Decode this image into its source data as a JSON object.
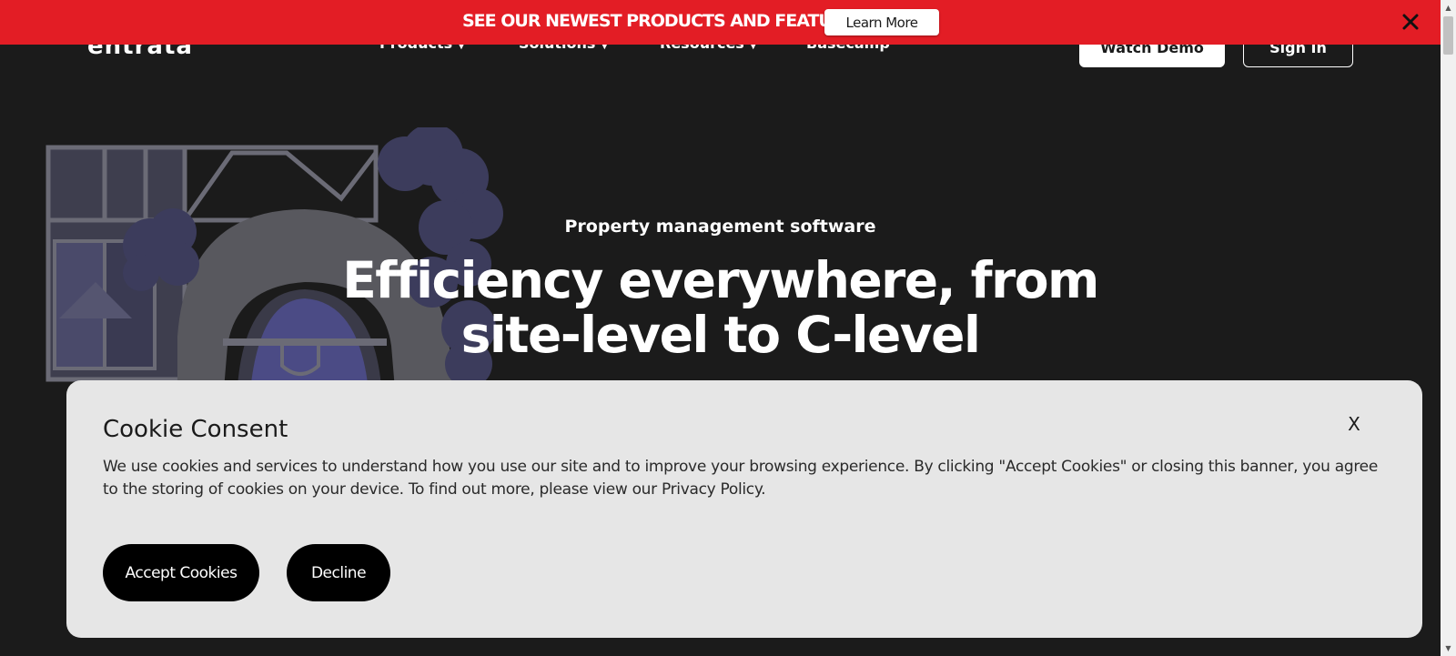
{
  "promo": {
    "text": "SEE OUR NEWEST PRODUCTS AND FEATURES",
    "button_label": "Learn More",
    "close_icon": "close-icon",
    "background": "#e31d25"
  },
  "header": {
    "logo": "entrata",
    "nav": [
      {
        "label": "Products",
        "icon": "chevron-down-icon"
      },
      {
        "label": "Solutions",
        "icon": "chevron-down-icon"
      },
      {
        "label": "Resources",
        "icon": "chevron-down-icon"
      },
      {
        "label": "Basecamp"
      }
    ],
    "watch_demo_label": "Watch Demo",
    "sign_in_label": "Sign In"
  },
  "hero": {
    "eyebrow": "Property management software",
    "title_line1": "Efficiency everywhere, from",
    "title_line2": "site-level to C-level"
  },
  "cookie": {
    "title": "Cookie Consent",
    "close_label": "X",
    "text": "We use cookies and services to understand how you use our site and to improve your browsing experience. By clicking \"Accept Cookies\" or closing this banner, you agree to the storing of cookies on your device. To find out more, please view our Privacy Policy.",
    "accept_label": "Accept Cookies",
    "decline_label": "Decline",
    "background": "#e6e6e6"
  },
  "colors": {
    "page_background": "#1b1b1b",
    "illustration": "#5a5a6a"
  }
}
